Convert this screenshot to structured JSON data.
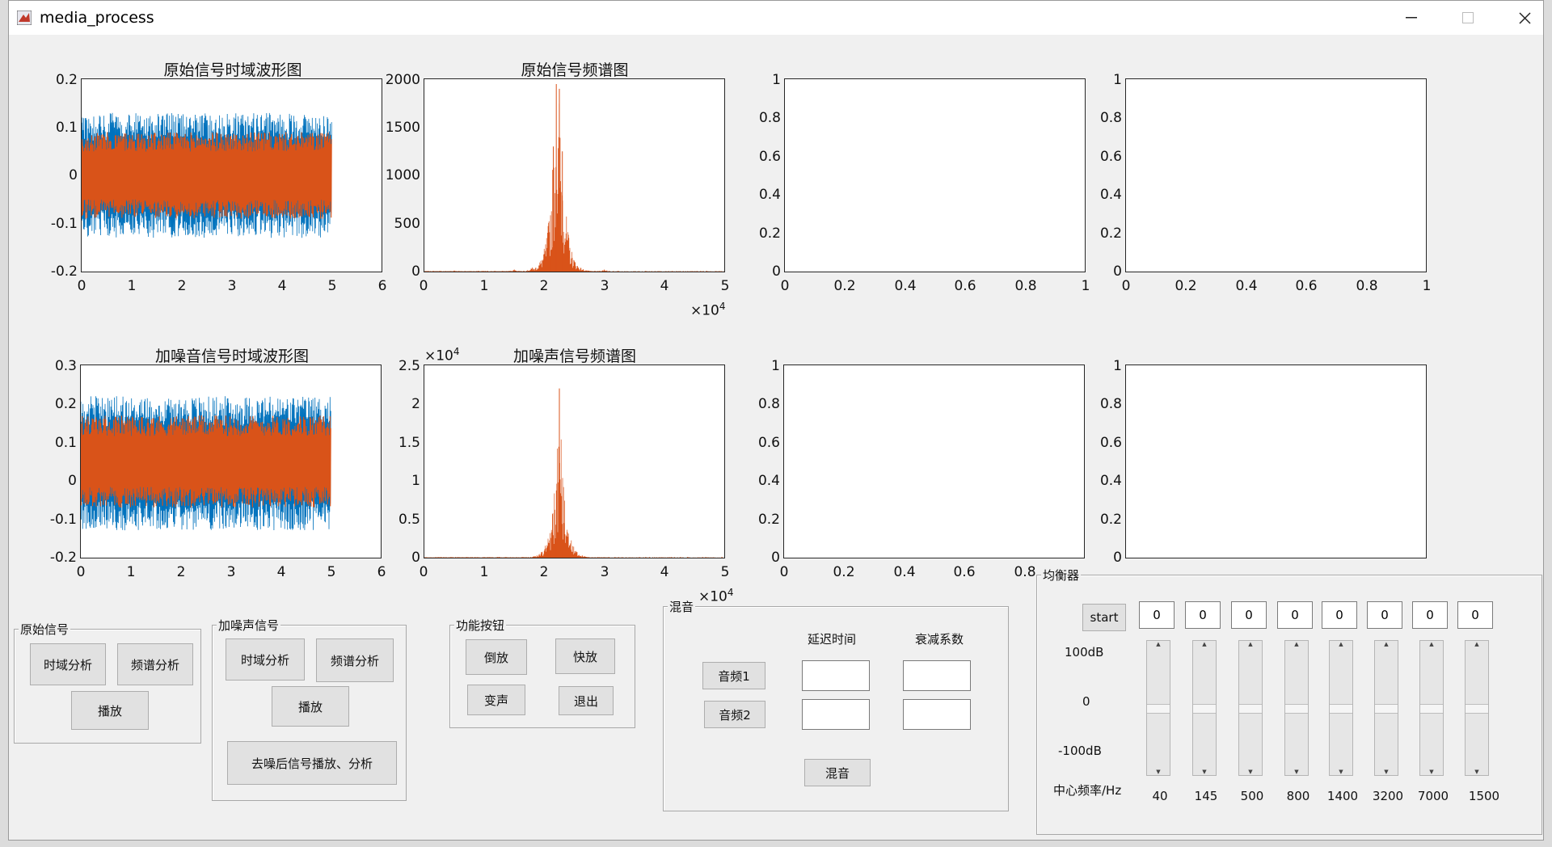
{
  "window": {
    "title": "media_process"
  },
  "charts": {
    "c1": {
      "title": "原始信号时域波形图",
      "yticks": [
        "0.2",
        "0.1",
        "0",
        "-0.1",
        "-0.2"
      ],
      "xticks": [
        "0",
        "1",
        "2",
        "3",
        "4",
        "5",
        "6"
      ],
      "exp": ""
    },
    "c2": {
      "title": "原始信号频谱图",
      "yticks": [
        "2000",
        "1500",
        "1000",
        "500",
        "0"
      ],
      "xticks": [
        "0",
        "1",
        "2",
        "3",
        "4",
        "5"
      ],
      "exp": "×10",
      "exp_pow": "4"
    },
    "c3": {
      "title": "",
      "yticks": [
        "1",
        "0.8",
        "0.6",
        "0.4",
        "0.2",
        "0"
      ],
      "xticks": [
        "0",
        "0.2",
        "0.4",
        "0.6",
        "0.8",
        "1"
      ]
    },
    "c4": {
      "title": "",
      "yticks": [
        "1",
        "0.8",
        "0.6",
        "0.4",
        "0.2",
        "0"
      ],
      "xticks": [
        "0",
        "0.2",
        "0.4",
        "0.6",
        "0.8",
        "1"
      ]
    },
    "c5": {
      "title": "加噪音信号时域波形图",
      "yticks": [
        "0.3",
        "0.2",
        "0.1",
        "0",
        "-0.1",
        "-0.2"
      ],
      "xticks": [
        "0",
        "1",
        "2",
        "3",
        "4",
        "5",
        "6"
      ]
    },
    "c6": {
      "title": "加噪声信号频谱图",
      "yticks": [
        "2.5",
        "2",
        "1.5",
        "1",
        "0.5",
        "0"
      ],
      "xticks": [
        "0",
        "1",
        "2",
        "3",
        "4",
        "5"
      ],
      "exp": "×10",
      "exp_pow": "4",
      "yexp": "×10",
      "yexp_pow": "4"
    },
    "c7": {
      "title": "",
      "yticks": [
        "1",
        "0.8",
        "0.6",
        "0.4",
        "0.2",
        "0"
      ],
      "xticks": [
        "0",
        "0.2",
        "0.4",
        "0.6",
        "0.8"
      ]
    },
    "c8": {
      "title": "",
      "yticks": [
        "1",
        "0.8",
        "0.6",
        "0.4",
        "0.2",
        "0"
      ],
      "xticks": []
    }
  },
  "chart_data": [
    {
      "type": "line",
      "title": "原始信号时域波形图",
      "xlim": [
        0,
        6
      ],
      "ylim": [
        -0.2,
        0.2
      ],
      "series": [
        {
          "values": [
            -0.13,
            0.13
          ]
        },
        {
          "values": [
            -0.09,
            0.09
          ]
        }
      ]
    },
    {
      "type": "line",
      "title": "原始信号频谱图",
      "xlim": [
        0,
        50000
      ],
      "ylim": [
        0,
        2000
      ],
      "x": [
        5000,
        15000,
        18000,
        21000,
        21500,
        22000,
        22500,
        23000,
        25000,
        30000
      ],
      "values": [
        10,
        20,
        40,
        150,
        1300,
        1950,
        1900,
        1250,
        60,
        20
      ]
    },
    {
      "type": "line",
      "title": "",
      "xlim": [
        0,
        1
      ],
      "ylim": [
        0,
        1
      ],
      "values": []
    },
    {
      "type": "line",
      "title": "",
      "xlim": [
        0,
        1
      ],
      "ylim": [
        0,
        1
      ],
      "values": []
    },
    {
      "type": "line",
      "title": "加噪音信号时域波形图",
      "xlim": [
        0,
        6
      ],
      "ylim": [
        -0.2,
        0.3
      ],
      "series": [
        {
          "values": [
            -0.13,
            0.22
          ]
        },
        {
          "values": [
            -0.07,
            0.17
          ]
        }
      ]
    },
    {
      "type": "line",
      "title": "加噪声信号频谱图",
      "xlim": [
        0,
        50000
      ],
      "ylim": [
        0,
        25000
      ],
      "x": [
        21000,
        22000,
        22500,
        23000
      ],
      "values": [
        800,
        1800,
        22000,
        1000
      ]
    },
    {
      "type": "line",
      "title": "",
      "xlim": [
        0,
        1
      ],
      "ylim": [
        0,
        1
      ],
      "values": []
    },
    {
      "type": "line",
      "title": "",
      "xlim": [
        0,
        1
      ],
      "ylim": [
        0,
        1
      ],
      "values": []
    }
  ],
  "colors": {
    "series1": "#0072bd",
    "series2": "#d95319"
  },
  "panels": {
    "original": {
      "title": "原始信号",
      "time": "时域分析",
      "freq": "频谱分析",
      "play": "播放"
    },
    "noisy": {
      "title": "加噪声信号",
      "time": "时域分析",
      "freq": "频谱分析",
      "play": "播放",
      "denoise": "去噪后信号播放、分析"
    },
    "func": {
      "title": "功能按钮",
      "reverse": "倒放",
      "fast": "快放",
      "voice": "变声",
      "exit": "退出"
    },
    "mix": {
      "title": "混音",
      "delay_label": "延迟时间",
      "atten_label": "衰减系数",
      "audio1": "音频1",
      "audio2": "音频2",
      "mix": "混音"
    },
    "eq": {
      "title": "均衡器",
      "start": "start",
      "top_label": "100dB",
      "mid_label": "0",
      "bottom_label": "-100dB",
      "freq_label": "中心频率/Hz",
      "values": [
        "0",
        "0",
        "0",
        "0",
        "0",
        "0",
        "0",
        "0"
      ],
      "freqs": [
        "40",
        "145",
        "500",
        "800",
        "1400",
        "3200",
        "7000",
        "1500"
      ],
      "gains": [
        0,
        0,
        0,
        0,
        0,
        0,
        0,
        0
      ]
    }
  }
}
